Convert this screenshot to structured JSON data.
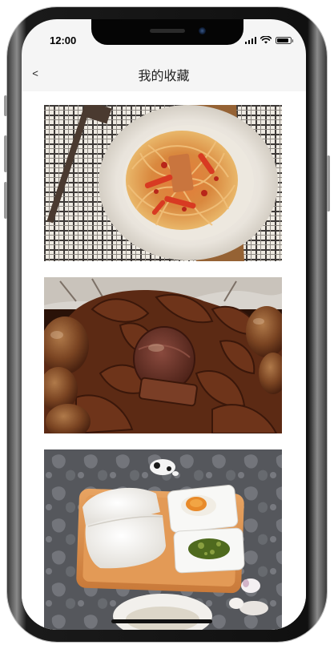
{
  "status_bar": {
    "time": "12:00",
    "battery_level": 0.9
  },
  "nav": {
    "back_label": "<",
    "title": "我的收藏"
  },
  "favorites": [
    {
      "name": "favorite-item-spaghetti"
    },
    {
      "name": "favorite-item-braised-meat"
    },
    {
      "name": "favorite-item-steamed-buns"
    }
  ]
}
